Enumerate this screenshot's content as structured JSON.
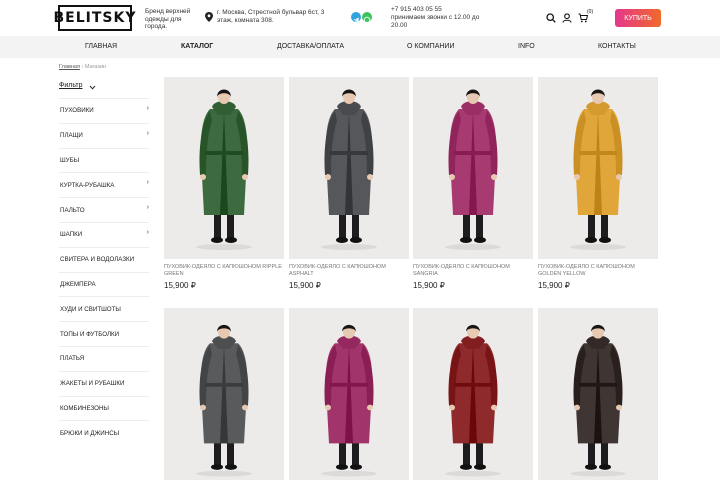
{
  "header": {
    "logo": "BELITSKY",
    "tagline": "Бренд верхней одежды для города.",
    "address": "г. Москва, Стрестной бульвар 6ст, 3 этаж, комната 308.",
    "phone": "+7 915 403 05 55",
    "hours": "принимаем звонки с 12.00 до 20.00",
    "cart_count": "(0)",
    "buy_label": "КУПИТЬ",
    "accent_gradient": [
      "#e4378d",
      "#f06a2a"
    ]
  },
  "nav": [
    {
      "label": "ГЛАВНАЯ"
    },
    {
      "label": "КАТАЛОГ"
    },
    {
      "label": "ДОСТАВКА/ОПЛАТА"
    },
    {
      "label": "О КОМПАНИИ"
    },
    {
      "label": "INFO"
    },
    {
      "label": "КОНТАКТЫ"
    }
  ],
  "breadcrumb": {
    "home": "Главная",
    "sep": "›",
    "current": "Магазин"
  },
  "filter_label": "Фильтр",
  "sidebar": [
    {
      "label": "ПУХОВИКИ",
      "chevron": "›"
    },
    {
      "label": "ПЛАЩИ",
      "chevron": "›"
    },
    {
      "label": "ШУБЫ",
      "chevron": ""
    },
    {
      "label": "КУРТКА-РУБАШКА",
      "chevron": "›"
    },
    {
      "label": "ПАЛЬТО",
      "chevron": "›"
    },
    {
      "label": "ШАПКИ",
      "chevron": "›"
    },
    {
      "label": "СВИТЕРА И ВОДОЛАЗКИ",
      "chevron": ""
    },
    {
      "label": "ДЖЕМПЕРА",
      "chevron": ""
    },
    {
      "label": "ХУДИ И СВИТШОТЫ",
      "chevron": ""
    },
    {
      "label": "ТОПЫ И ФУТБОЛКИ",
      "chevron": ""
    },
    {
      "label": "ПЛАТЬЯ",
      "chevron": ""
    },
    {
      "label": "ЖАКЕТЫ И РУБАШКИ",
      "chevron": ""
    },
    {
      "label": "КОМБИНЕЗОНЫ",
      "chevron": ""
    },
    {
      "label": "БРЮКИ И ДЖИНСЫ",
      "chevron": ""
    }
  ],
  "products": [
    {
      "name": "ПУХОВИК-ОДЕЯЛО С КАПЮШОНОМ RIPPLE GREEN",
      "price": "15,900 ₽",
      "color": "#3d6b3f"
    },
    {
      "name": "ПУХОВИК-ОДЕЯЛО С КАПЮШОНОМ ASPHALT",
      "price": "15,900 ₽",
      "color": "#55575a"
    },
    {
      "name": "ПУХОВИК-ОДЕЯЛО С КАПЮШОНОМ SANGRIA",
      "price": "15,900 ₽",
      "color": "#a83a72"
    },
    {
      "name": "ПУХОВИК-ОДЕЯЛО С КАПЮШОНОМ GOLDEN YELLOW",
      "price": "15,900 ₽",
      "color": "#e1a63a"
    },
    {
      "name": "",
      "price": "",
      "color": "#595a5c"
    },
    {
      "name": "",
      "price": "",
      "color": "#a1346a"
    },
    {
      "name": "",
      "price": "",
      "color": "#8e2a2c"
    },
    {
      "name": "",
      "price": "",
      "color": "#3f3533"
    }
  ]
}
